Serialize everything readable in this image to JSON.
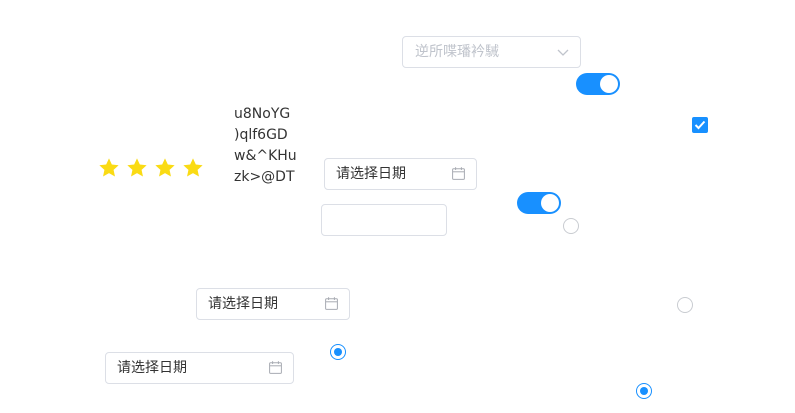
{
  "colors": {
    "accent": "#1890ff",
    "star": "#fadb14",
    "border": "#dcdfe6"
  },
  "select": {
    "placeholder": "逆所喋璠衿駴",
    "icon": "chevron-down-icon"
  },
  "switches": [
    {
      "checked": true
    },
    {
      "checked": true
    }
  ],
  "checkbox": {
    "checked": true
  },
  "text_lines": [
    "u8NoYG",
    ")qlf6GD",
    "w&^KHu",
    "zk>@DT"
  ],
  "rating": {
    "value": 4,
    "max": 4,
    "icon": "star-icon"
  },
  "date_pickers": [
    {
      "placeholder": "请选择日期",
      "icon": "calendar-icon"
    },
    {
      "placeholder": "请选择日期",
      "icon": "calendar-icon"
    },
    {
      "placeholder": "请选择日期",
      "icon": "calendar-icon"
    }
  ],
  "text_input": {
    "value": ""
  },
  "radios": [
    {
      "checked": false
    },
    {
      "checked": false
    },
    {
      "checked": true
    },
    {
      "checked": true
    }
  ]
}
